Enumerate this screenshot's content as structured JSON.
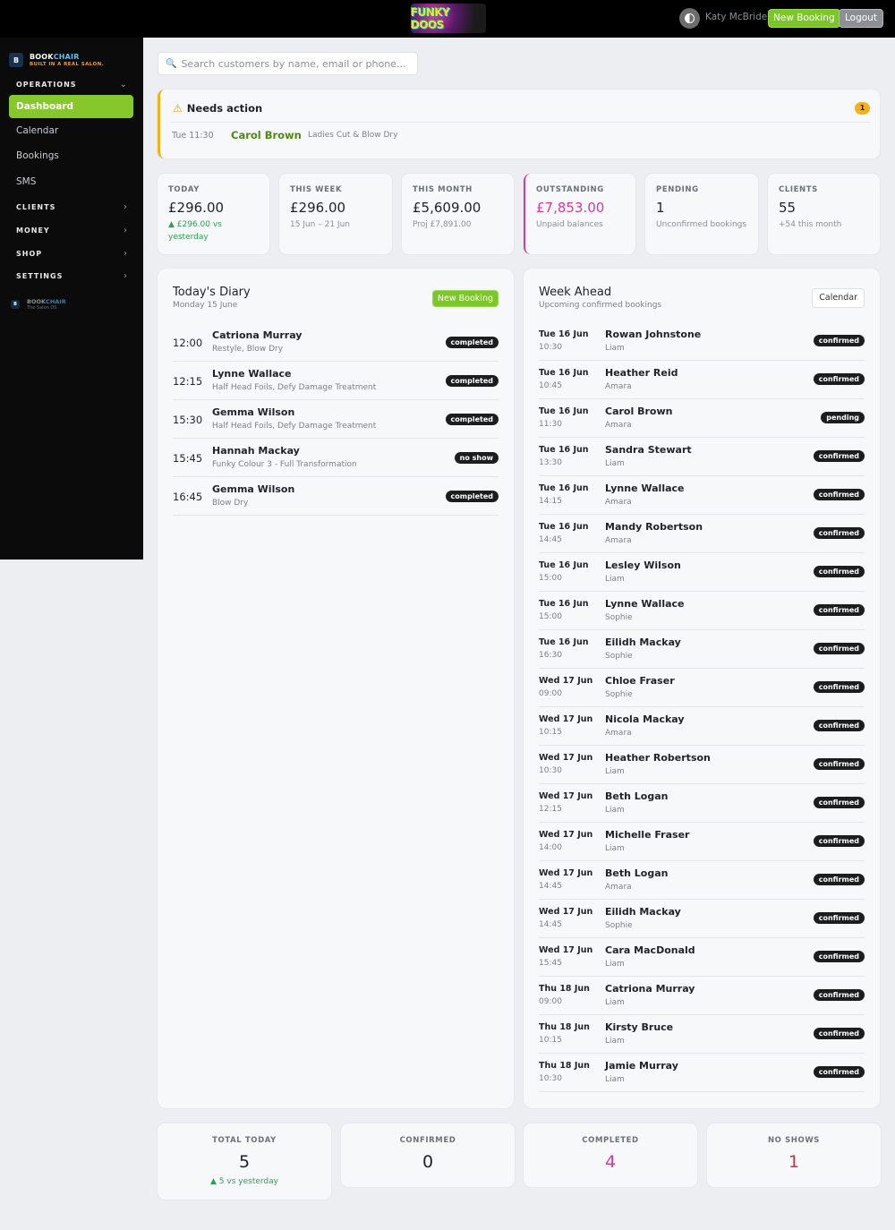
{
  "header": {
    "logo_text": "FUNKY DOOS",
    "user_name": "Katy McBride",
    "new_booking_label": "New Booking",
    "logout_label": "Logout",
    "theme_icon": "contrast-icon"
  },
  "sidebar": {
    "brand_part1": "BOOK",
    "brand_part2": "CHAIR",
    "brand_tagline": "BUILT IN A REAL SALON.",
    "sections": {
      "operations": "OPERATIONS",
      "clients": "CLIENTS",
      "money": "MONEY",
      "shop": "SHOP",
      "settings": "SETTINGS"
    },
    "items": {
      "dashboard": "Dashboard",
      "calendar": "Calendar",
      "bookings": "Bookings",
      "sms": "SMS"
    },
    "footer_part1": "BOOK",
    "footer_part2": "CHAIR",
    "footer_tagline": "The Salon OS"
  },
  "search": {
    "placeholder": "Search customers by name, email or phone..."
  },
  "needs_action": {
    "title": "Needs action",
    "count": "1",
    "item": {
      "time": "Tue 11:30",
      "name": "Carol Brown",
      "service": "Ladies Cut & Blow Dry"
    }
  },
  "stats": [
    {
      "label": "TODAY",
      "value": "£296.00",
      "sub": "▲ £296.00 vs yesterday"
    },
    {
      "label": "THIS WEEK",
      "value": "£296.00",
      "sub": "15 Jun – 21 Jun"
    },
    {
      "label": "THIS MONTH",
      "value": "£5,609.00",
      "sub": "Proj £7,891.00"
    },
    {
      "label": "OUTSTANDING",
      "value": "£7,853.00",
      "sub": "Unpaid balances"
    },
    {
      "label": "PENDING",
      "value": "1",
      "sub": "Unconfirmed bookings"
    },
    {
      "label": "CLIENTS",
      "value": "55",
      "sub": "+54 this month"
    }
  ],
  "diary": {
    "title": "Today's Diary",
    "subtitle": "Monday 15 June",
    "button": "New Booking",
    "rows": [
      {
        "time": "12:00",
        "name": "Catriona Murray",
        "service": "Restyle, Blow Dry",
        "status": "completed"
      },
      {
        "time": "12:15",
        "name": "Lynne Wallace",
        "service": "Half Head Foils, Defy Damage Treatment",
        "status": "completed"
      },
      {
        "time": "15:30",
        "name": "Gemma Wilson",
        "service": "Half Head Foils, Defy Damage Treatment",
        "status": "completed"
      },
      {
        "time": "15:45",
        "name": "Hannah Mackay",
        "service": "Funky Colour 3 - Full Transformation",
        "status": "no show"
      },
      {
        "time": "16:45",
        "name": "Gemma Wilson",
        "service": "Blow Dry",
        "status": "completed"
      }
    ]
  },
  "week": {
    "title": "Week Ahead",
    "subtitle": "Upcoming confirmed bookings",
    "button": "Calendar",
    "rows": [
      {
        "date": "Tue 16 Jun",
        "time": "10:30",
        "name": "Rowan Johnstone",
        "staff": "Liam",
        "status": "confirmed"
      },
      {
        "date": "Tue 16 Jun",
        "time": "10:45",
        "name": "Heather Reid",
        "staff": "Amara",
        "status": "confirmed"
      },
      {
        "date": "Tue 16 Jun",
        "time": "11:30",
        "name": "Carol Brown",
        "staff": "Amara",
        "status": "pending"
      },
      {
        "date": "Tue 16 Jun",
        "time": "13:30",
        "name": "Sandra Stewart",
        "staff": "Liam",
        "status": "confirmed"
      },
      {
        "date": "Tue 16 Jun",
        "time": "14:15",
        "name": "Lynne Wallace",
        "staff": "Amara",
        "status": "confirmed"
      },
      {
        "date": "Tue 16 Jun",
        "time": "14:45",
        "name": "Mandy Robertson",
        "staff": "Amara",
        "status": "confirmed"
      },
      {
        "date": "Tue 16 Jun",
        "time": "15:00",
        "name": "Lesley Wilson",
        "staff": "Liam",
        "status": "confirmed"
      },
      {
        "date": "Tue 16 Jun",
        "time": "15:00",
        "name": "Lynne Wallace",
        "staff": "Sophie",
        "status": "confirmed"
      },
      {
        "date": "Tue 16 Jun",
        "time": "16:30",
        "name": "Eilidh Mackay",
        "staff": "Sophie",
        "status": "confirmed"
      },
      {
        "date": "Wed 17 Jun",
        "time": "09:00",
        "name": "Chloe Fraser",
        "staff": "Sophie",
        "status": "confirmed"
      },
      {
        "date": "Wed 17 Jun",
        "time": "10:15",
        "name": "Nicola Mackay",
        "staff": "Amara",
        "status": "confirmed"
      },
      {
        "date": "Wed 17 Jun",
        "time": "10:30",
        "name": "Heather Robertson",
        "staff": "Liam",
        "status": "confirmed"
      },
      {
        "date": "Wed 17 Jun",
        "time": "12:15",
        "name": "Beth Logan",
        "staff": "Liam",
        "status": "confirmed"
      },
      {
        "date": "Wed 17 Jun",
        "time": "14:00",
        "name": "Michelle Fraser",
        "staff": "Liam",
        "status": "confirmed"
      },
      {
        "date": "Wed 17 Jun",
        "time": "14:45",
        "name": "Beth Logan",
        "staff": "Amara",
        "status": "confirmed"
      },
      {
        "date": "Wed 17 Jun",
        "time": "14:45",
        "name": "Eilidh Mackay",
        "staff": "Sophie",
        "status": "confirmed"
      },
      {
        "date": "Wed 17 Jun",
        "time": "15:45",
        "name": "Cara MacDonald",
        "staff": "Liam",
        "status": "confirmed"
      },
      {
        "date": "Thu 18 Jun",
        "time": "09:00",
        "name": "Catriona Murray",
        "staff": "Liam",
        "status": "confirmed"
      },
      {
        "date": "Thu 18 Jun",
        "time": "10:15",
        "name": "Kirsty Bruce",
        "staff": "Liam",
        "status": "confirmed"
      },
      {
        "date": "Thu 18 Jun",
        "time": "10:30",
        "name": "Jamie Murray",
        "staff": "Liam",
        "status": "confirmed"
      }
    ]
  },
  "summary": [
    {
      "label": "TOTAL TODAY",
      "value": "5",
      "sub": "▲ 5 vs yesterday"
    },
    {
      "label": "CONFIRMED",
      "value": "0",
      "sub": ""
    },
    {
      "label": "COMPLETED",
      "value": "4",
      "sub": ""
    },
    {
      "label": "NO SHOWS",
      "value": "1",
      "sub": ""
    }
  ],
  "colors": {
    "accent_green": "#7cc62b",
    "outstanding_pink": "#d63aa0",
    "warning_amber": "#f0b21a",
    "no_show_red": "#d6264e"
  }
}
